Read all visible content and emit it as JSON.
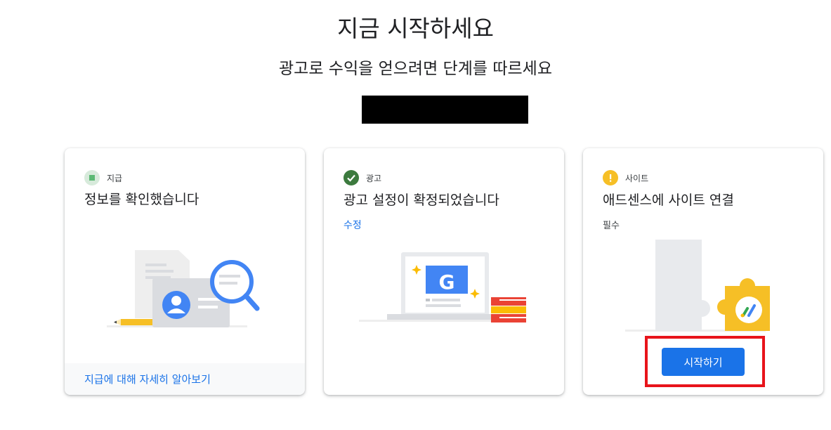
{
  "header": {
    "title": "지금 시작하세요",
    "subtitle": "광고로 수익을 얻으려면 단계를 따르세요"
  },
  "cards": [
    {
      "badge_label": "지급",
      "badge_icon": "square-status-icon",
      "title": "정보를 확인했습니다",
      "footer_link": "지급에 대해 자세히 알아보기"
    },
    {
      "badge_label": "광고",
      "badge_icon": "check-icon",
      "title": "광고 설정이 확정되었습니다",
      "sub_link": "수정",
      "illustration_letter": "G"
    },
    {
      "badge_label": "사이트",
      "badge_icon": "exclamation-icon",
      "title": "애드센스에 사이트 연결",
      "sub_text": "필수",
      "button_label": "시작하기"
    }
  ],
  "colors": {
    "primary": "#1a73e8",
    "success": "#3c7a3e",
    "warning": "#f6bf26",
    "highlight": "#e8141b"
  }
}
